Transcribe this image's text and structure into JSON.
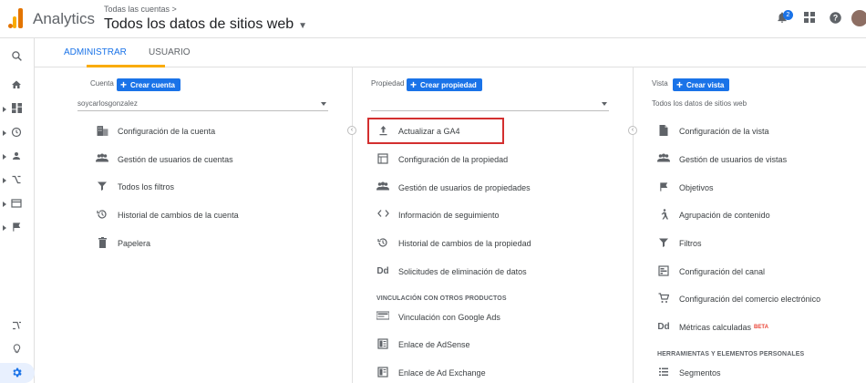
{
  "header": {
    "app_name": "Analytics",
    "breadcrumb": "Todas las cuentas >",
    "property_title": "Todos los datos de sitios web",
    "notification_count": "2"
  },
  "tabs": [
    {
      "label": "ADMINISTRAR",
      "active": true
    },
    {
      "label": "USUARIO",
      "active": false
    }
  ],
  "account": {
    "header": "Cuenta",
    "create_label": "Crear cuenta",
    "selected": "soycarlosgonzalez",
    "items": [
      {
        "label": "Configuración de la cuenta",
        "icon": "building-icon"
      },
      {
        "label": "Gestión de usuarios de cuentas",
        "icon": "people-icon"
      },
      {
        "label": "Todos los filtros",
        "icon": "filter-icon"
      },
      {
        "label": "Historial de cambios de la cuenta",
        "icon": "history-icon"
      },
      {
        "label": "Papelera",
        "icon": "trash-icon"
      }
    ]
  },
  "property": {
    "header": "Propiedad",
    "create_label": "Crear propiedad",
    "selected": "",
    "items": [
      {
        "label": "Actualizar a GA4",
        "icon": "upload-icon"
      },
      {
        "label": "Configuración de la propiedad",
        "icon": "window-icon"
      },
      {
        "label": "Gestión de usuarios de propiedades",
        "icon": "people-icon"
      },
      {
        "label": "Información de seguimiento",
        "icon": "code-icon"
      },
      {
        "label": "Historial de cambios de la propiedad",
        "icon": "history-icon"
      },
      {
        "label": "Solicitudes de eliminación de datos",
        "icon": "dd-icon",
        "glyph": "Dd"
      }
    ],
    "section_label": "VINCULACIÓN CON OTROS PRODUCTOS",
    "linked": [
      {
        "label": "Vinculación con Google Ads",
        "icon": "google-ads-icon"
      },
      {
        "label": "Enlace de AdSense",
        "icon": "adsense-icon"
      },
      {
        "label": "Enlace de Ad Exchange",
        "icon": "ad-exchange-icon"
      }
    ]
  },
  "view": {
    "header": "Vista",
    "create_label": "Crear vista",
    "selected": "Todos los datos de sitios web",
    "items": [
      {
        "label": "Configuración de la vista",
        "icon": "document-icon"
      },
      {
        "label": "Gestión de usuarios de vistas",
        "icon": "people-icon"
      },
      {
        "label": "Objetivos",
        "icon": "flag-icon"
      },
      {
        "label": "Agrupación de contenido",
        "icon": "person-walk-icon"
      },
      {
        "label": "Filtros",
        "icon": "filter-icon"
      },
      {
        "label": "Configuración del canal",
        "icon": "channel-icon"
      },
      {
        "label": "Configuración del comercio electrónico",
        "icon": "cart-icon"
      },
      {
        "label": "Métricas calculadas",
        "icon": "dd-icon",
        "glyph": "Dd",
        "badge": "BETA"
      }
    ],
    "section_label": "HERRAMIENTAS Y ELEMENTOS PERSONALES",
    "tools": [
      {
        "label": "Segmentos",
        "icon": "segments-icon"
      }
    ]
  }
}
